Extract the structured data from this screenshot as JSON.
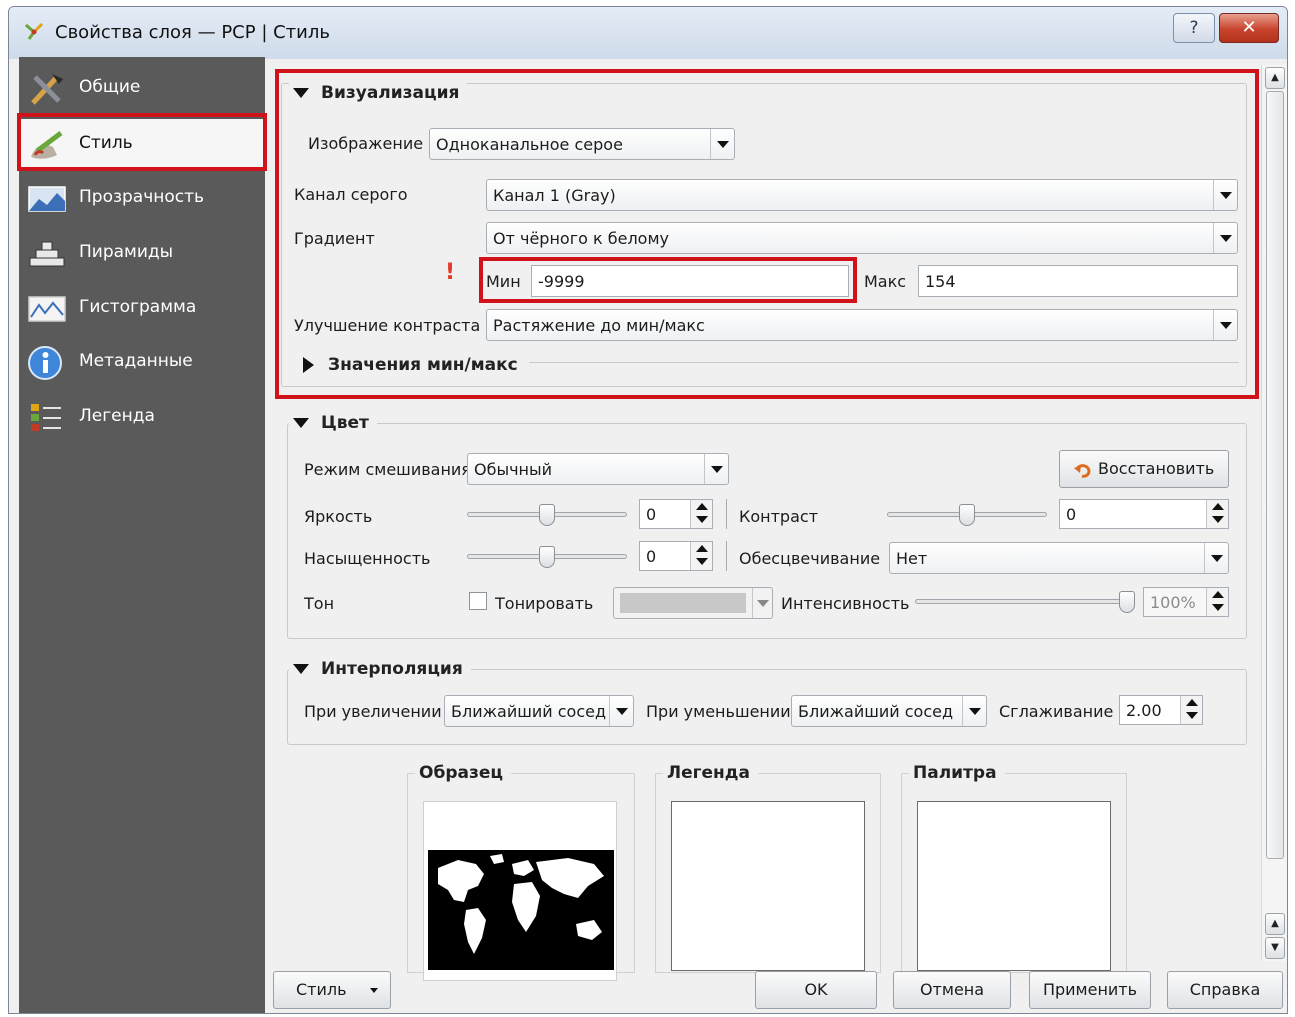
{
  "window": {
    "title": "Свойства слоя — PCP | Стиль",
    "help_label": "?",
    "close_label": "✕"
  },
  "sidebar": {
    "items": [
      {
        "label": "Общие",
        "icon": "tools-icon"
      },
      {
        "label": "Стиль",
        "icon": "brush-icon"
      },
      {
        "label": "Прозрачность",
        "icon": "transparency-icon"
      },
      {
        "label": "Пирамиды",
        "icon": "pyramid-icon"
      },
      {
        "label": "Гистограмма",
        "icon": "histogram-icon"
      },
      {
        "label": "Метаданные",
        "icon": "info-icon"
      },
      {
        "label": "Легенда",
        "icon": "legend-icon"
      }
    ],
    "selected": "Стиль"
  },
  "visualization": {
    "title": "Визуализация",
    "render_type_label": "Изображение",
    "render_type_value": "Одноканальное серое",
    "gray_band_label": "Канал серого",
    "gray_band_value": "Канал 1 (Gray)",
    "gradient_label": "Градиент",
    "gradient_value": "От чёрного к белому",
    "warning_mark": "!",
    "min_label": "Мин",
    "min_value": "-9999",
    "max_label": "Макс",
    "max_value": "154",
    "contrast_label": "Улучшение контраста",
    "contrast_value": "Растяжение до мин/макс",
    "minmax_section_title": "Значения мин/макс"
  },
  "color": {
    "title": "Цвет",
    "blend_label": "Режим смешивания",
    "blend_value": "Обычный",
    "reset_label": "Восстановить",
    "brightness_label": "Яркость",
    "brightness_value": "0",
    "contrast_label": "Контраст",
    "contrast_value": "0",
    "saturation_label": "Насыщенность",
    "saturation_value": "0",
    "grayscale_label": "Обесцвечивание",
    "grayscale_value": "Нет",
    "hue_label": "Тон",
    "colorize_label": "Тонировать",
    "colorize_checked": false,
    "colorize_color": "#c8c8c8",
    "strength_label": "Интенсивность",
    "strength_value": "100%",
    "brightness_level": 0.5,
    "contrast_level": 0.5,
    "saturation_level": 0.5,
    "strength_level": 1.0
  },
  "interpolation": {
    "title": "Интерполяция",
    "zoomed_in_label": "При увеличении",
    "zoomed_in_value": "Ближайший сосед",
    "zoomed_out_label": "При уменьшении",
    "zoomed_out_value": "Ближайший сосед",
    "oversampling_label": "Сглаживание",
    "oversampling_value": "2.00"
  },
  "previews": {
    "sample_title": "Образец",
    "legend_title": "Легенда",
    "palette_title": "Палитра"
  },
  "footer": {
    "style_label": "Стиль",
    "ok_label": "OK",
    "cancel_label": "Отмена",
    "apply_label": "Применить",
    "help_label": "Справка"
  },
  "colors": {
    "highlight_red": "#d0121b",
    "sidebar_bg": "#5a5a5a",
    "window_bg": "#f0f0f0"
  }
}
